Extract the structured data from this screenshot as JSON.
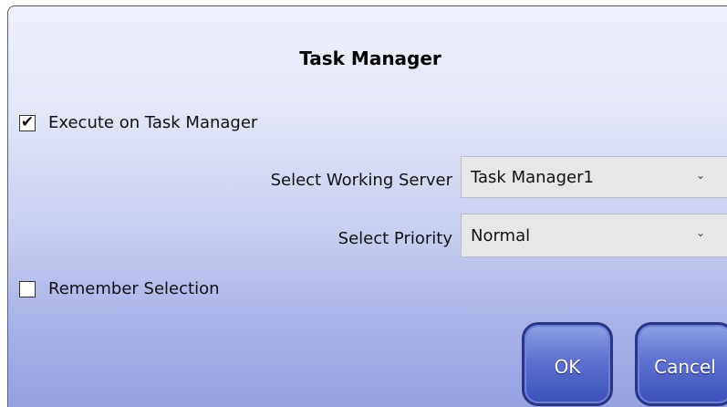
{
  "dialog": {
    "title": "Task Manager",
    "execute_checkbox": {
      "label": "Execute on Task Manager",
      "checked": true,
      "glyph": "✔"
    },
    "working_server": {
      "label": "Select Working Server",
      "value": "Task Manager1"
    },
    "priority": {
      "label": "Select Priority",
      "value": "Normal"
    },
    "remember_checkbox": {
      "label": "Remember Selection",
      "checked": false
    },
    "buttons": {
      "ok": "OK",
      "cancel": "Cancel"
    },
    "chevron_glyph": "⌄"
  },
  "colors": {
    "button_fill": "#5f72d0",
    "button_border": "#2b3585",
    "dialog_gradient_bottom": "#97a1e2"
  }
}
